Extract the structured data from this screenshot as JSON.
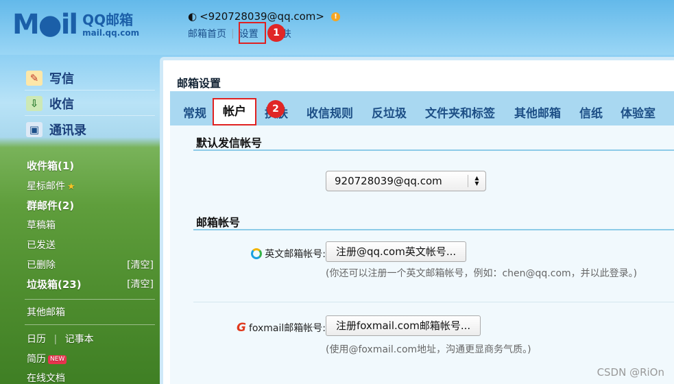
{
  "header": {
    "logo_mark": "M●il",
    "logo_cn": "QQ邮箱",
    "logo_domain": "mail.qq.com",
    "user_email": "<920728039@qq.com>",
    "links": {
      "home": "邮箱首页",
      "separator": "|",
      "settings": "设置",
      "skin": "肤"
    }
  },
  "markers": {
    "first": "1",
    "second": "2"
  },
  "sidebar": {
    "compose": "写信",
    "inbox": "收信",
    "contacts": "通讯录",
    "folders": {
      "inbox": "收件箱(1)",
      "starred": "星标邮件",
      "group": "群邮件(2)",
      "drafts": "草稿箱",
      "sent": "已发送",
      "deleted": "已删除",
      "spam": "垃圾箱(23)",
      "clear": "[清空]",
      "other": "其他邮箱",
      "calendar": "日历",
      "notes": "记事本",
      "resume": "简历",
      "new_badge": "NEW",
      "docs": "在线文档"
    }
  },
  "main": {
    "title": "邮箱设置",
    "tabs": [
      "常规",
      "帐户",
      "换肤",
      "收信规则",
      "反垃圾",
      "文件夹和标签",
      "其他邮箱",
      "信纸",
      "体验室"
    ],
    "default_sender": {
      "title": "默认发信帐号",
      "value": "920728039@qq.com"
    },
    "accounts": {
      "title": "邮箱帐号",
      "english_label": "英文邮箱帐号:",
      "english_button": "注册@qq.com英文帐号...",
      "english_hint": "(你还可以注册一个英文邮箱帐号，例如：chen@qq.com，并以此登录。)",
      "foxmail_label": "foxmail邮箱帐号:",
      "foxmail_button": "注册foxmail.com邮箱帐号...",
      "foxmail_hint": "(使用@foxmail.com地址，沟通更显商务气质。)"
    }
  },
  "watermark": "CSDN @RiOn"
}
